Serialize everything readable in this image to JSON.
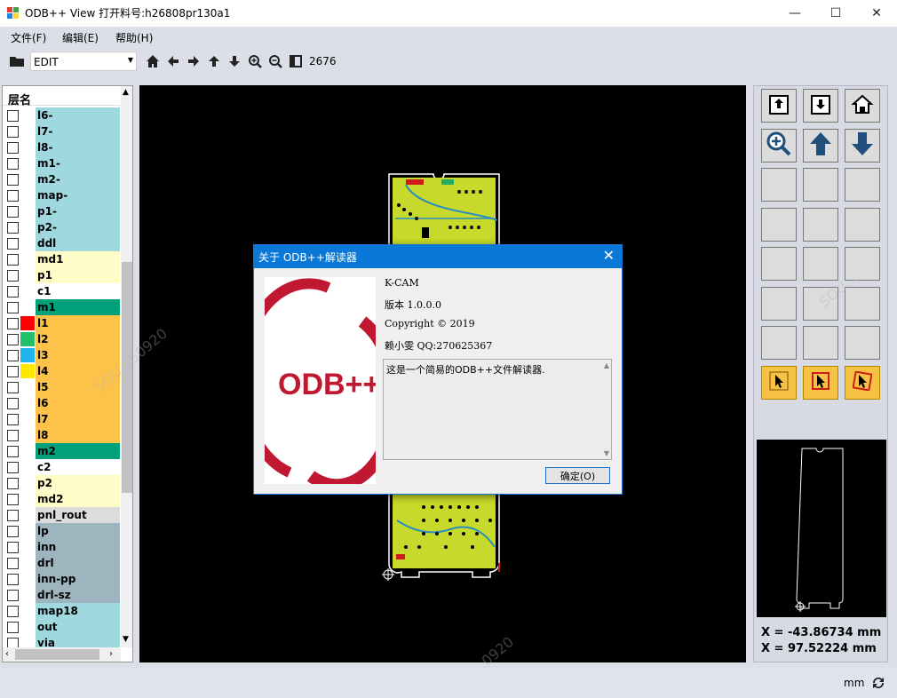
{
  "window": {
    "title": "ODB++ View 打开料号:h26808pr130a1"
  },
  "menu": [
    "文件(F)",
    "编辑(E)",
    "帮助(H)"
  ],
  "toolbar": {
    "mode": "EDIT",
    "count": "2676"
  },
  "layers": {
    "header": "层名",
    "items": [
      {
        "name": "l6-",
        "bg": "#a0d8e0",
        "swatch": ""
      },
      {
        "name": "l7-",
        "bg": "#a0d8e0",
        "swatch": ""
      },
      {
        "name": "l8-",
        "bg": "#a0d8e0",
        "swatch": ""
      },
      {
        "name": "m1-",
        "bg": "#a0d8e0",
        "swatch": ""
      },
      {
        "name": "m2-",
        "bg": "#a0d8e0",
        "swatch": ""
      },
      {
        "name": "map-",
        "bg": "#a0d8e0",
        "swatch": ""
      },
      {
        "name": "p1-",
        "bg": "#a0d8e0",
        "swatch": ""
      },
      {
        "name": "p2-",
        "bg": "#a0d8e0",
        "swatch": ""
      },
      {
        "name": "ddl",
        "bg": "#a0d8e0",
        "swatch": ""
      },
      {
        "name": "md1",
        "bg": "#fffcc8",
        "swatch": ""
      },
      {
        "name": "p1",
        "bg": "#fffcc8",
        "swatch": ""
      },
      {
        "name": "c1",
        "bg": "#ffffff",
        "swatch": ""
      },
      {
        "name": "m1",
        "bg": "#00a07a",
        "swatch": ""
      },
      {
        "name": "l1",
        "bg": "#fcc24a",
        "swatch": "#ff0000"
      },
      {
        "name": "l2",
        "bg": "#fcc24a",
        "swatch": "#22c06a"
      },
      {
        "name": "l3",
        "bg": "#fcc24a",
        "swatch": "#1eb4f0"
      },
      {
        "name": "l4",
        "bg": "#fcc24a",
        "swatch": "#ffe800"
      },
      {
        "name": "l5",
        "bg": "#fcc24a",
        "swatch": ""
      },
      {
        "name": "l6",
        "bg": "#fcc24a",
        "swatch": ""
      },
      {
        "name": "l7",
        "bg": "#fcc24a",
        "swatch": ""
      },
      {
        "name": "l8",
        "bg": "#fcc24a",
        "swatch": ""
      },
      {
        "name": "m2",
        "bg": "#00a07a",
        "swatch": ""
      },
      {
        "name": "c2",
        "bg": "#ffffff",
        "swatch": ""
      },
      {
        "name": "p2",
        "bg": "#fffcc8",
        "swatch": ""
      },
      {
        "name": "md2",
        "bg": "#fffcc8",
        "swatch": ""
      },
      {
        "name": "pnl_rout",
        "bg": "#dcdcdc",
        "swatch": ""
      },
      {
        "name": "lp",
        "bg": "#9eb4bf",
        "swatch": ""
      },
      {
        "name": "inn",
        "bg": "#9eb4bf",
        "swatch": ""
      },
      {
        "name": "drl",
        "bg": "#9eb4bf",
        "swatch": ""
      },
      {
        "name": "inn-pp",
        "bg": "#9eb4bf",
        "swatch": ""
      },
      {
        "name": "drl-sz",
        "bg": "#9eb4bf",
        "swatch": ""
      },
      {
        "name": "map18",
        "bg": "#a0d8e0",
        "swatch": ""
      },
      {
        "name": "out",
        "bg": "#a0d8e0",
        "swatch": ""
      },
      {
        "name": "via",
        "bg": "#a0d8e0",
        "swatch": ""
      }
    ]
  },
  "coords": {
    "x": "X = -43.86734 mm",
    "y": "X = 97.52224 mm"
  },
  "status": {
    "unit": "mm"
  },
  "dialog": {
    "title": "关于 ODB++解读器",
    "product": "K-CAM",
    "version": "版本 1.0.0.0",
    "copyright": "Copyright ©  2019",
    "author": "赖小雯 QQ:270625367",
    "description": "这是一个简易的ODB++文件解读器.",
    "ok_label": "确定(O)",
    "logo_text": "ODB++"
  },
  "watermarks": [
    "SOU...50920",
    "SO...0920",
    "SOU..."
  ]
}
